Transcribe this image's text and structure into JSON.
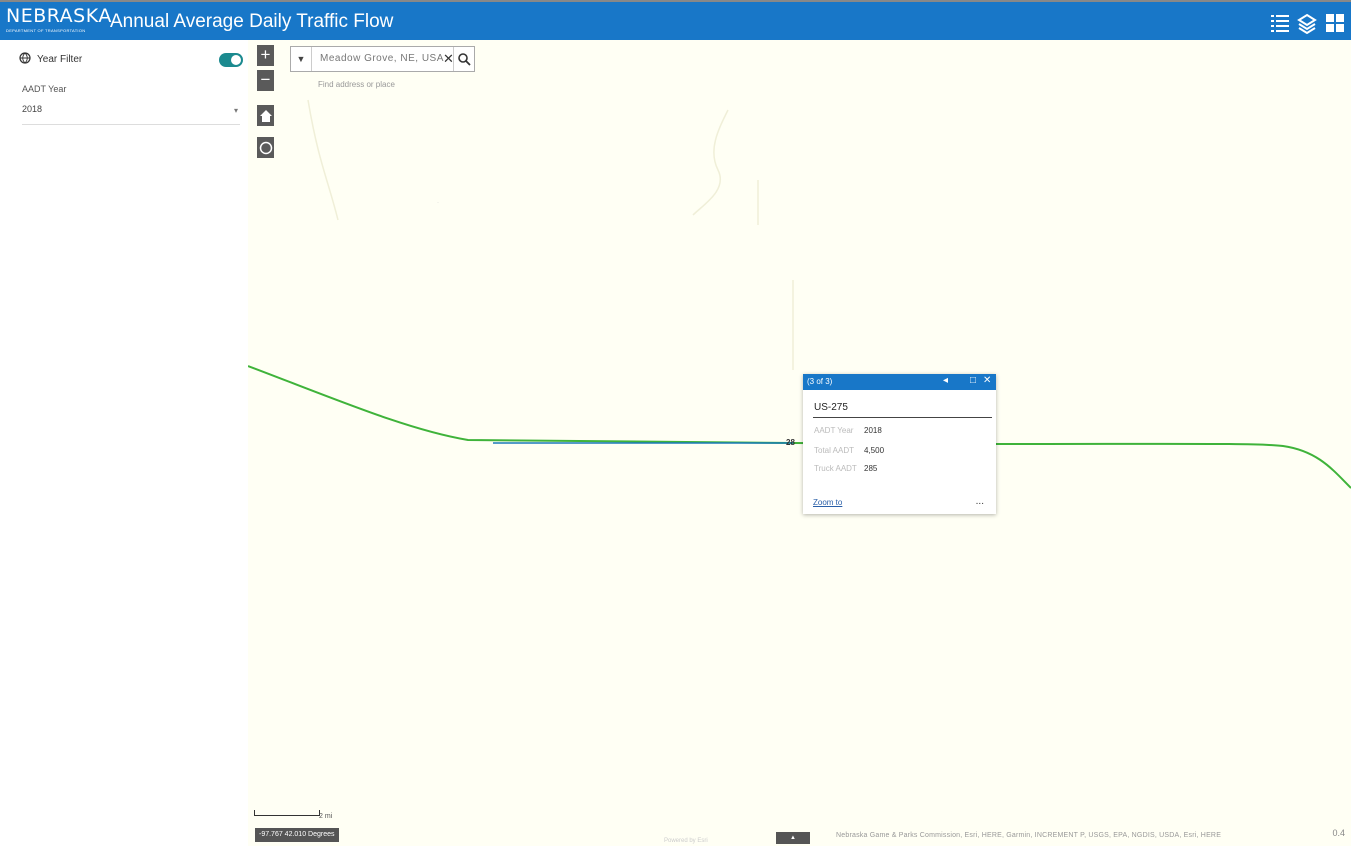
{
  "header": {
    "logo_text": "NEBRASKA",
    "logo_subtext": "DEPARTMENT OF TRANSPORTATION",
    "title": "Annual Average Daily Traffic Flow"
  },
  "sidebar": {
    "filter_title": "Year Filter",
    "field_label": "AADT Year",
    "selected_year": "2018"
  },
  "map": {
    "search_value": "Meadow Grove, NE, USA",
    "search_hint": "Find address or place",
    "corner_label": "",
    "popup": {
      "counter": "(3 of 3)",
      "title": "US-275",
      "rows": [
        {
          "label": "AADT Year",
          "value": "2018"
        },
        {
          "label": "Total AADT",
          "value": "4,500"
        },
        {
          "label": "Truck AADT",
          "value": "285"
        }
      ],
      "zoom_label": "Zoom to",
      "more_label": "..."
    },
    "road_label": "28",
    "scale_label": "2 mi",
    "coordinates": "-97.767 42.010 Degrees",
    "powered_by": "Powered by Esri",
    "attribution": "Nebraska Game & Parks Commission, Esri, HERE, Garmin, INCREMENT P, USGS, EPA, NGDIS, USDA, Esri, HERE",
    "attribution_toggle": "▲",
    "footer_zoom": "0.4"
  }
}
